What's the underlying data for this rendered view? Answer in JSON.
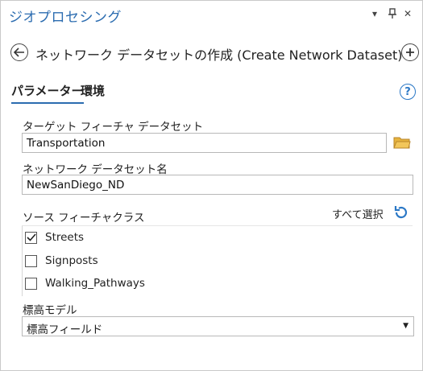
{
  "pane": {
    "title": "ジオプロセシング",
    "controls": {
      "dropdown": "▾",
      "pin": "⫫",
      "close": "✕"
    }
  },
  "tool": {
    "title": "ネットワーク データセットの作成 (Create Network Dataset)"
  },
  "tabs": [
    {
      "label": "パラメーター",
      "active": true
    },
    {
      "label": "環境",
      "active": false
    }
  ],
  "help": {
    "label": "?"
  },
  "params": {
    "target_dataset": {
      "label": "ターゲット フィーチャ データセット",
      "value": "Transportation"
    },
    "dataset_name": {
      "label": "ネットワーク データセット名",
      "value": "NewSanDiego_ND"
    },
    "source_classes": {
      "label": "ソース フィーチャクラス",
      "select_all": "すべて選択",
      "items": [
        {
          "label": "Streets",
          "checked": true
        },
        {
          "label": "Signposts",
          "checked": false
        },
        {
          "label": "Walking_Pathways",
          "checked": false
        }
      ]
    },
    "elevation_model": {
      "label": "標高モデル",
      "value": "標高フィールド"
    }
  },
  "colors": {
    "accent": "#2b6cb0",
    "folder": "#e6b33d",
    "help": "#2b78c6"
  }
}
